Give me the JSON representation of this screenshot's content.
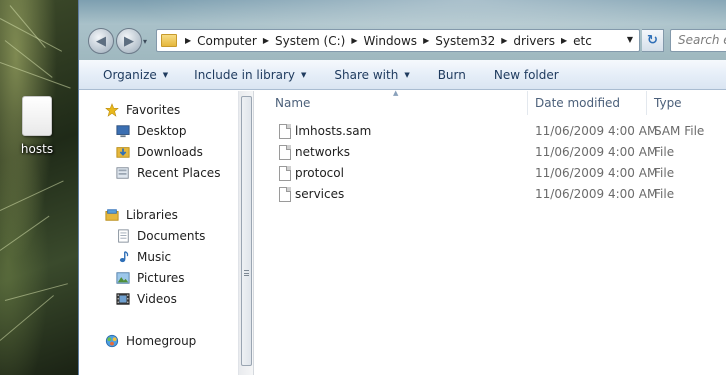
{
  "desktop": {
    "icon_label": "hosts"
  },
  "navigation": {
    "back_glyph": "◀",
    "forward_glyph": "▶",
    "recent_glyph": "▾",
    "refresh_glyph": "↻"
  },
  "address_bar": {
    "breadcrumbs": [
      "Computer",
      "System (C:)",
      "Windows",
      "System32",
      "drivers",
      "etc"
    ],
    "dropdown_glyph": "▼"
  },
  "search": {
    "placeholder": "Search etc"
  },
  "toolbar": {
    "organize": "Organize",
    "include_in_library": "Include in library",
    "share_with": "Share with",
    "burn": "Burn",
    "new_folder": "New folder",
    "caret": "▼"
  },
  "nav_pane": {
    "favorites": "Favorites",
    "desktop": "Desktop",
    "downloads": "Downloads",
    "recent_places": "Recent Places",
    "libraries": "Libraries",
    "documents": "Documents",
    "music": "Music",
    "pictures": "Pictures",
    "videos": "Videos",
    "homegroup": "Homegroup"
  },
  "columns": {
    "name": "Name",
    "date_modified": "Date modified",
    "type": "Type",
    "sort_glyph": "▲"
  },
  "files": [
    {
      "name": "lmhosts.sam",
      "date": "11/06/2009 4:00 AM",
      "type": "SAM File"
    },
    {
      "name": "networks",
      "date": "11/06/2009 4:00 AM",
      "type": "File"
    },
    {
      "name": "protocol",
      "date": "11/06/2009 4:00 AM",
      "type": "File"
    },
    {
      "name": "services",
      "date": "11/06/2009 4:00 AM",
      "type": "File"
    }
  ],
  "colors": {
    "toolbar_text": "#1e3a5e",
    "column_header_text": "#4c607a",
    "secondary_text": "#6b6b6b",
    "favorites_star": "#e8b81c",
    "selection_blue": "#2f6fb7"
  }
}
